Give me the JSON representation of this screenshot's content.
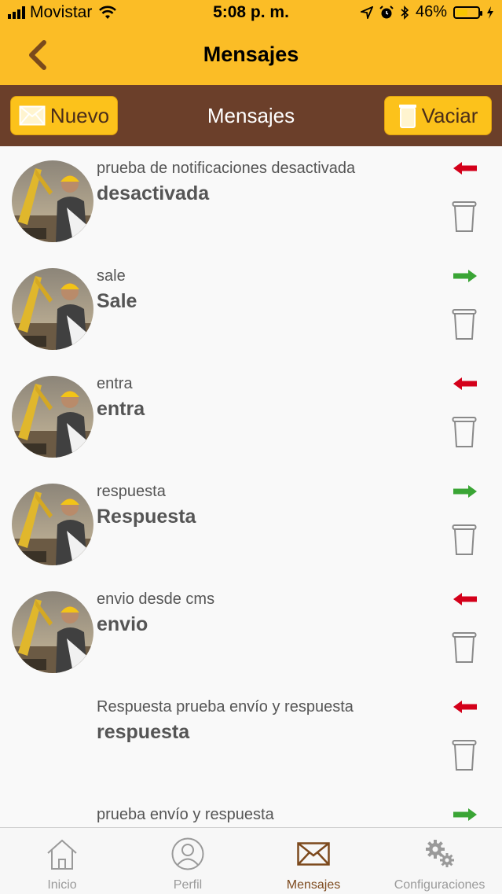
{
  "status_bar": {
    "carrier": "Movistar",
    "time": "5:08 p. m.",
    "battery_percent": "46%",
    "battery_level": 0.46
  },
  "nav": {
    "title": "Mensajes"
  },
  "toolbar": {
    "new_label": "Nuevo",
    "title": "Mensajes",
    "clear_label": "Vaciar"
  },
  "colors": {
    "accent": "#fbbd26",
    "toolbar_bg": "#6b3f2a",
    "incoming_arrow": "#d4001a",
    "outgoing_arrow": "#3aa535"
  },
  "messages": [
    {
      "subtitle": "prueba de notificaciones desactivada",
      "title": "desactivada",
      "direction": "incoming",
      "has_avatar": true
    },
    {
      "subtitle": "sale",
      "title": "Sale",
      "direction": "outgoing",
      "has_avatar": true
    },
    {
      "subtitle": "entra",
      "title": "entra",
      "direction": "incoming",
      "has_avatar": true
    },
    {
      "subtitle": "respuesta",
      "title": "Respuesta",
      "direction": "outgoing",
      "has_avatar": true
    },
    {
      "subtitle": "envio desde cms",
      "title": "envio",
      "direction": "incoming",
      "has_avatar": true
    },
    {
      "subtitle": "Respuesta prueba envío y respuesta",
      "title": "respuesta",
      "direction": "incoming",
      "has_avatar": false
    },
    {
      "subtitle": "prueba envío y respuesta",
      "title": "",
      "direction": "outgoing",
      "has_avatar": false
    }
  ],
  "tabs": [
    {
      "label": "Inicio",
      "icon": "home-icon",
      "active": false
    },
    {
      "label": "Perfil",
      "icon": "profile-icon",
      "active": false
    },
    {
      "label": "Mensajes",
      "icon": "envelope-icon",
      "active": true
    },
    {
      "label": "Configuraciones",
      "icon": "gears-icon",
      "active": false
    }
  ]
}
